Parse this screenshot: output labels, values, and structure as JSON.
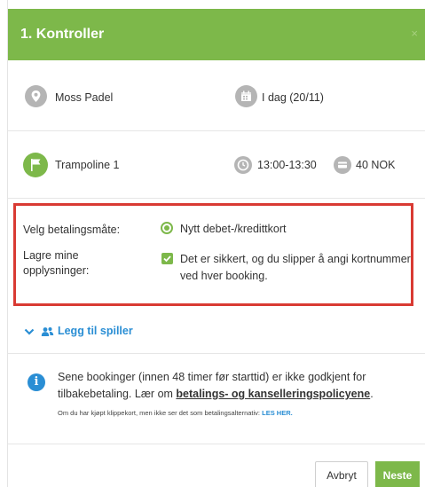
{
  "header": {
    "title": "1. Kontroller",
    "close_label": "×"
  },
  "booking": {
    "location": "Moss Padel",
    "date": "I dag (20/11)",
    "court": "Trampoline 1",
    "time": "13:00-13:30",
    "price": "40 NOK"
  },
  "payment": {
    "method_label": "Velg betalingsmåte:",
    "method_option": "Nytt debet-/kredittkort",
    "save_label": "Lagre mine opplysninger:",
    "save_option": "Det er sikkert, og du slipper å angi kortnummer ved hver booking."
  },
  "add_player": {
    "label": "Legg til spiller"
  },
  "info": {
    "text_part1": "Sene bookinger (innen 48 timer før starttid) er ikke godkjent for tilbakebetaling. Lær om ",
    "policy_link": "betalings- og kanselleringspolicyene",
    "text_part2": ".",
    "note_text": "Om du har kjøpt klippekort, men ikke ser det som betalingsalternativ: ",
    "note_link": "LES HER."
  },
  "footer": {
    "cancel_label": "Avbryt",
    "next_label": "Neste"
  },
  "icons": {
    "location": "map-pin-icon",
    "date": "calendar-icon",
    "court": "flag-icon",
    "time": "clock-icon",
    "price": "card-icon",
    "add_player": "users-icon",
    "info": "info-icon"
  },
  "colors": {
    "brand_green": "#7db84a",
    "highlight_red": "#d93a33",
    "link_blue": "#2a8ed4",
    "icon_gray": "#b5b5b5"
  }
}
